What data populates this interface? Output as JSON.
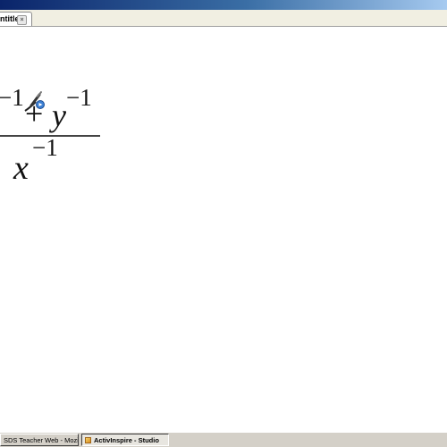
{
  "window": {
    "tab_label": "Untitled*",
    "tab_close_glyph": "×",
    "tab_close_icon": "close-icon"
  },
  "expression": {
    "numerator_exponent_left": "−1",
    "numerator_operator": "+",
    "numerator_variable": "y",
    "numerator_exponent_right": "−1",
    "denominator_variable": "x",
    "denominator_exponent": "−1"
  },
  "cursor": {
    "icon": "pen-tool-icon",
    "color": "#3b7fd4"
  },
  "taskbar": {
    "items": [
      {
        "label": "SDS Teacher Web - Mozil...",
        "active": false
      },
      {
        "label": "ActivInspire - Studio",
        "active": true
      }
    ]
  },
  "colors": {
    "title_band": "#0a246a",
    "taskbar": "#d4d0c8",
    "ink": "#111111"
  }
}
